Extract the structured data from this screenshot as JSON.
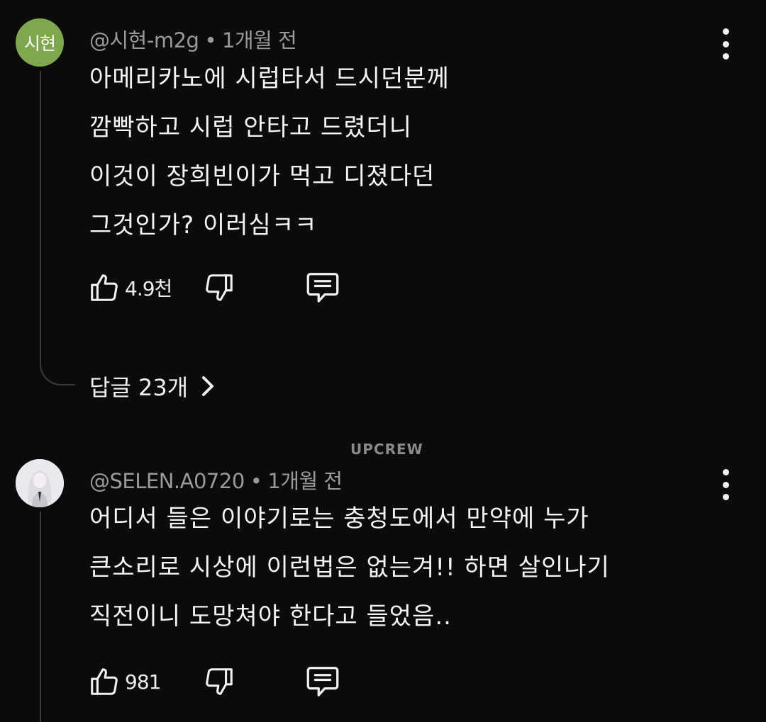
{
  "comments": [
    {
      "avatar_text": "시현",
      "author": "@시현-m2g",
      "time": "1개월 전",
      "lines": [
        "아메리카노에 시럽타서 드시던분께",
        "깜빡하고 시럽 안타고 드렸더니",
        "이것이 장희빈이가 먹고 디졌다던",
        "그것인가? 이러심ㅋㅋ"
      ],
      "likes": "4.9천",
      "replies_label": "답글 23개",
      "avatar_color": "#7fa84e"
    },
    {
      "author": "@SELEN.A0720",
      "time": "1개월 전",
      "lines": [
        "어디서 들은 이야기로는 충청도에서 만약에 누가",
        "큰소리로 시상에 이런법은 없는겨!! 하면 살인나기",
        "직전이니 도망쳐야 한다고 들었음.."
      ],
      "likes": "981"
    }
  ],
  "watermark": "UPCREW",
  "separator": "•",
  "icons": {
    "like": "thumbs-up-icon",
    "dislike": "thumbs-down-icon",
    "reply": "comment-icon",
    "more": "more-vertical-icon",
    "replies_chevron": "chevron-right-icon"
  }
}
